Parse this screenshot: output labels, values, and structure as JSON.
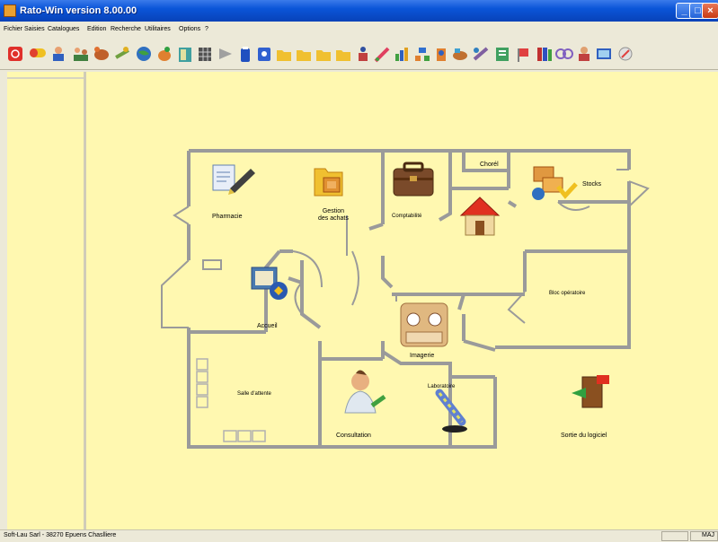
{
  "window": {
    "title": "Rato-Win version 8.00.00"
  },
  "menu": [
    "Fichier",
    "Saisies",
    "Catalogues",
    "Edition",
    "Recherche",
    "Utilitaires",
    "Options",
    "?"
  ],
  "plan": {
    "pharmacy": "Pharmacie",
    "stock_mgmt_1": "Gestion",
    "stock_mgmt_2": "des achats",
    "accounting": "Comptabilité",
    "office": "Chorél",
    "stocks": "Stocks",
    "operating_room": "Bloc opératoire",
    "reception": "Accueil",
    "imaging": "Imagerie",
    "waiting_room": "Salle d'attente",
    "laboratory": "Laboratoire",
    "consultation": "Consultation",
    "exit": "Sortie du logiciel"
  },
  "status": {
    "left": "Soft-Lau Sarl - 38270 Epuens Chaslliere",
    "right": "MAJ"
  },
  "colors": {
    "background": "#fff8b0",
    "walls": "#9a9a9a",
    "titlebar": "#0a55d8"
  }
}
